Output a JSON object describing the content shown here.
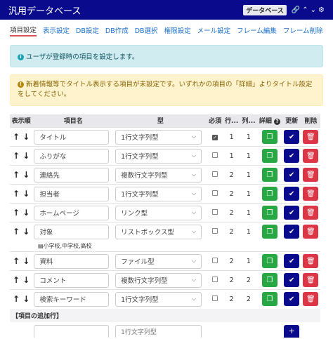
{
  "header": {
    "title": "汎用データベース",
    "badge": "データベース",
    "icons": [
      "link-icon",
      "chevron-up-icon",
      "chevron-down-icon",
      "gear-icon"
    ]
  },
  "tabs": [
    {
      "label": "項目設定",
      "active": true
    },
    {
      "label": "表示設定"
    },
    {
      "label": "DB設定"
    },
    {
      "label": "DB作成"
    },
    {
      "label": "DB選択"
    },
    {
      "label": "権限設定"
    },
    {
      "label": "メール設定"
    },
    {
      "label": "フレーム編集"
    },
    {
      "label": "フレーム削除"
    }
  ],
  "alerts": {
    "info": "ユーザが登録時の項目を設定します。",
    "warning": "新着情報等でタイトル表示する項目が未設定です。いずれかの項目の「詳細」よりタイトル設定をしてください。"
  },
  "table": {
    "headers": {
      "order": "表示順",
      "name": "項目名",
      "type": "型",
      "required": "必須",
      "row": "行...",
      "col": "列...",
      "detail": "詳細",
      "update": "更新",
      "delete": "削除"
    },
    "rows": [
      {
        "name": "タイトル",
        "type": "1行文字列型",
        "required": true,
        "row": "1",
        "col": "1"
      },
      {
        "name": "ふりがな",
        "type": "1行文字列型",
        "required": false,
        "row": "1",
        "col": "1"
      },
      {
        "name": "連絡先",
        "type": "複数行文字列型",
        "required": false,
        "row": "2",
        "col": "1"
      },
      {
        "name": "担当者",
        "type": "1行文字列型",
        "required": false,
        "row": "2",
        "col": "1"
      },
      {
        "name": "ホームページ",
        "type": "リンク型",
        "required": false,
        "row": "2",
        "col": "1"
      },
      {
        "name": "対象",
        "type": "リストボックス型",
        "required": false,
        "row": "2",
        "col": "1",
        "choices": "小学校,中学校,高校"
      },
      {
        "name": "資料",
        "type": "ファイル型",
        "required": false,
        "row": "2",
        "col": "1"
      },
      {
        "name": "コメント",
        "type": "複数行文字列型",
        "required": false,
        "row": "2",
        "col": "2"
      },
      {
        "name": "検索キーワード",
        "type": "1行文字列型",
        "required": false,
        "row": "2",
        "col": "2"
      }
    ],
    "add_section": "【項目の追加行】",
    "add_type_placeholder": "1行文字列型"
  }
}
